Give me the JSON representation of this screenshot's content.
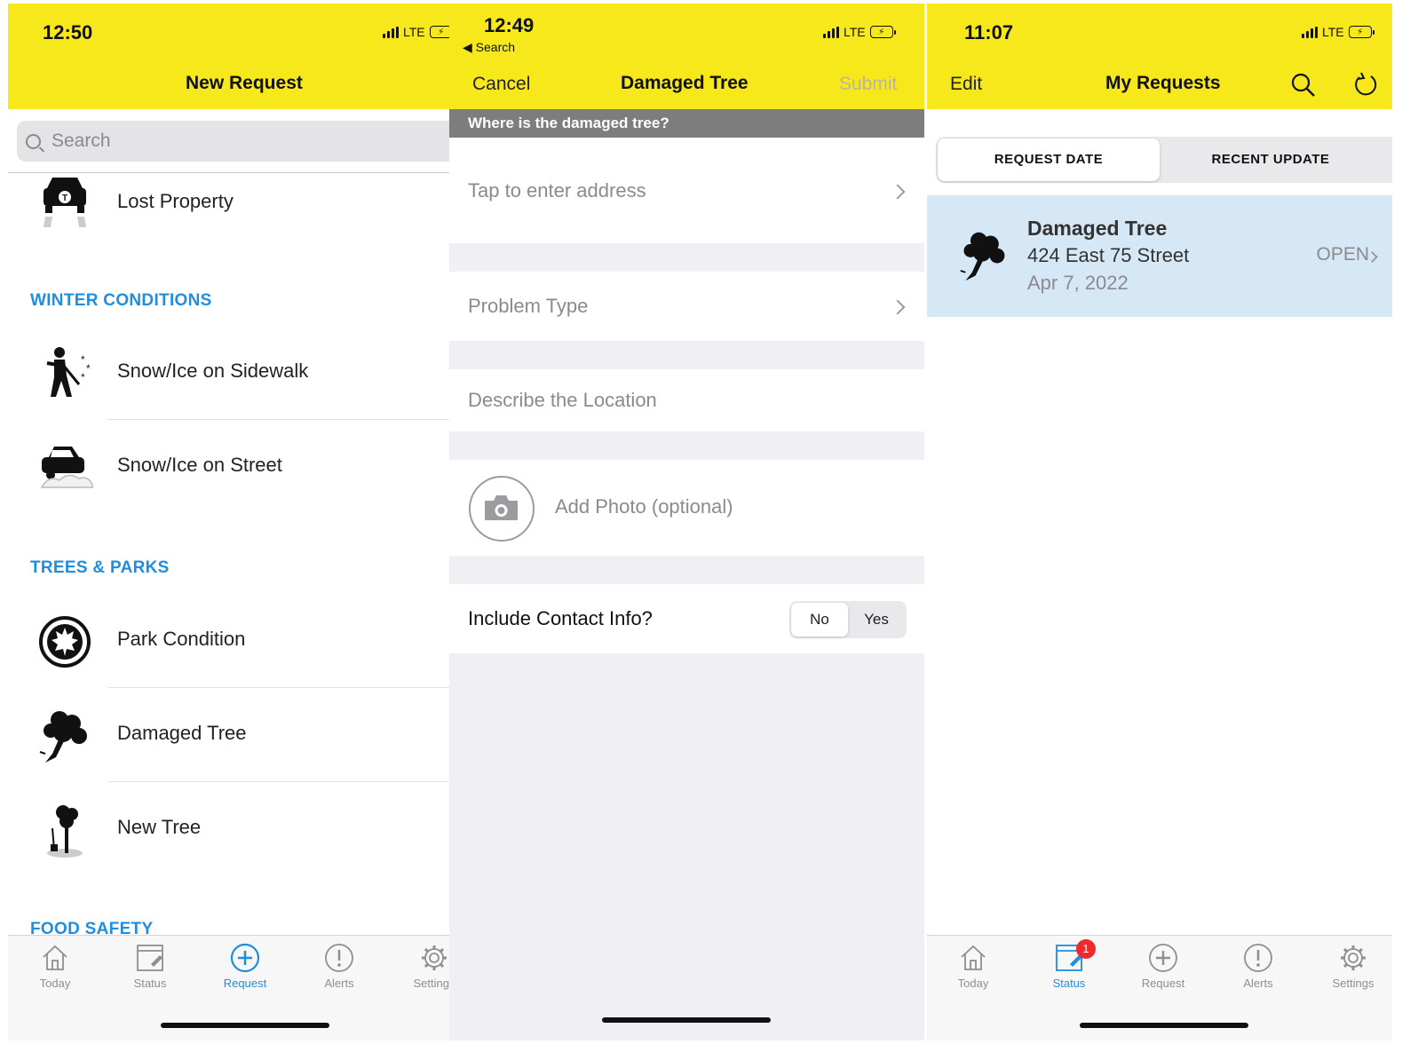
{
  "colors": {
    "header_yellow": "#f6e81a",
    "accent_blue": "#1f8ee0",
    "row_highlight": "#d6e8f5",
    "badge_red": "#ee2b2b"
  },
  "screen1": {
    "time": "12:50",
    "network": "LTE",
    "title": "New Request",
    "search_placeholder": "Search",
    "items": [
      {
        "label": "Lost Property",
        "icon": "taxi-icon"
      },
      {
        "label": "Snow/Ice on Sidewalk",
        "icon": "shoveling-person-icon"
      },
      {
        "label": "Snow/Ice on Street",
        "icon": "car-in-snow-icon"
      },
      {
        "label": "Park Condition",
        "icon": "parks-leaf-icon"
      },
      {
        "label": "Damaged Tree",
        "icon": "damaged-tree-icon"
      },
      {
        "label": "New Tree",
        "icon": "new-tree-icon"
      }
    ],
    "sections": [
      "WINTER CONDITIONS",
      "TREES & PARKS",
      "FOOD SAFETY"
    ],
    "tabs": [
      "Today",
      "Status",
      "Request",
      "Alerts",
      "Settings"
    ],
    "active_tab": "Request"
  },
  "screen2": {
    "time": "12:49",
    "back_label": "◀ Search",
    "network": "LTE",
    "cancel": "Cancel",
    "title": "Damaged Tree",
    "submit": "Submit",
    "prompt": "Where is the damaged tree?",
    "address_placeholder": "Tap to enter address",
    "problem_type": "Problem Type",
    "describe_location": "Describe the Location",
    "add_photo": "Add Photo (optional)",
    "contact_label": "Include Contact Info?",
    "contact_options": [
      "No",
      "Yes"
    ],
    "contact_selected": "No"
  },
  "screen3": {
    "time": "11:07",
    "network": "LTE",
    "edit": "Edit",
    "title": "My Requests",
    "sort_options": [
      "REQUEST DATE",
      "RECENT UPDATE"
    ],
    "sort_selected": "REQUEST DATE",
    "request": {
      "type": "Damaged Tree",
      "address": "424 East 75 Street",
      "date": "Apr 7, 2022",
      "status": "OPEN"
    },
    "tabs": [
      "Today",
      "Status",
      "Request",
      "Alerts",
      "Settings"
    ],
    "active_tab": "Status",
    "status_badge": "1"
  }
}
